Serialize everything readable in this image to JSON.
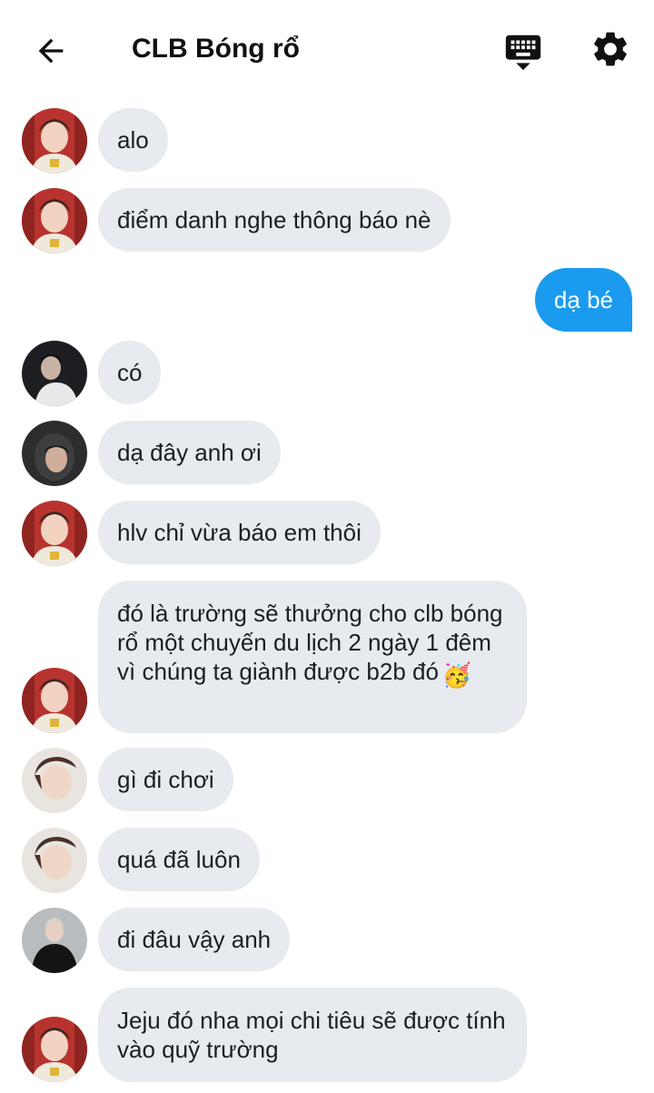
{
  "header": {
    "title": "CLB Bóng rổ",
    "back_icon": "arrow-left-icon",
    "keyboard_icon": "keyboard-hide-icon",
    "settings_icon": "gear-icon"
  },
  "messages": [
    {
      "text": "alo",
      "direction": "incoming",
      "avatar": "avatar-boy-red-bg"
    },
    {
      "text": "điểm danh nghe thông báo nè",
      "direction": "incoming",
      "avatar": "avatar-boy-red-bg"
    },
    {
      "text": "dạ bé",
      "direction": "outgoing"
    },
    {
      "text": "có",
      "direction": "incoming",
      "avatar": "avatar-boy-dark"
    },
    {
      "text": "dạ đây anh ơi",
      "direction": "incoming",
      "avatar": "avatar-hood-dark"
    },
    {
      "text": "hlv chỉ vừa báo em thôi",
      "direction": "incoming",
      "avatar": "avatar-boy-red-bg"
    },
    {
      "text": "đó là trường sẽ thưởng cho clb bóng rổ một chuyến du lịch 2 ngày 1 đêm vì chúng ta giành được b2b đó",
      "emoji": "🥳",
      "emoji_name": "party-face-emoji",
      "direction": "incoming",
      "avatar": "avatar-boy-red-bg"
    },
    {
      "text": "gì đi chơi",
      "direction": "incoming",
      "avatar": "avatar-boy-light"
    },
    {
      "text": "quá đã luôn",
      "direction": "incoming",
      "avatar": "avatar-boy-light"
    },
    {
      "text": "đi đâu vậy anh",
      "direction": "incoming",
      "avatar": "avatar-boy-black-jacket"
    },
    {
      "text": "Jeju đó nha mọi chi tiêu sẽ được tính vào quỹ trường",
      "direction": "incoming",
      "avatar": "avatar-boy-red-bg"
    }
  ],
  "colors": {
    "incoming_bubble": "#e7ebef",
    "outgoing_bubble": "#1a9bf0",
    "outgoing_text": "#ffffff",
    "text": "#1c1e21"
  }
}
